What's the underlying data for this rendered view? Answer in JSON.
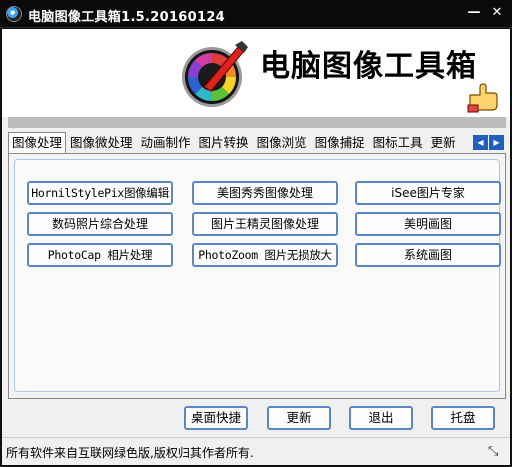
{
  "window": {
    "title": "电脑图像工具箱1.5.20160124",
    "min_glyph": "—",
    "close_glyph": "✕"
  },
  "header": {
    "title": "电脑图像工具箱"
  },
  "tabs": {
    "items": [
      "图像处理",
      "图像微处理",
      "动画制作",
      "图片转换",
      "图像浏览",
      "图像捕捉",
      "图标工具",
      "更新"
    ],
    "active": 0,
    "scroll_left": "◀",
    "scroll_right": "▶"
  },
  "apps": [
    "HornilStylePix图像编辑",
    "美图秀秀图像处理",
    "iSee图片专家",
    "数码照片综合处理",
    "图片王精灵图像处理",
    "美明画图",
    "PhotoCap 相片处理",
    "PhotoZoom 图片无损放大",
    "系统画图"
  ],
  "bottom_buttons": {
    "desktop_shortcut": "桌面快捷",
    "update": "更新",
    "exit": "退出",
    "tray": "托盘"
  },
  "status": {
    "text": "所有软件来自互联网绿色版,版权归其作者所有.",
    "grip": "⤡"
  },
  "colors": {
    "button_border": "#5b87c2",
    "titlebar": "#0b0b0b",
    "tab_scroll": "#1f5fbf"
  }
}
